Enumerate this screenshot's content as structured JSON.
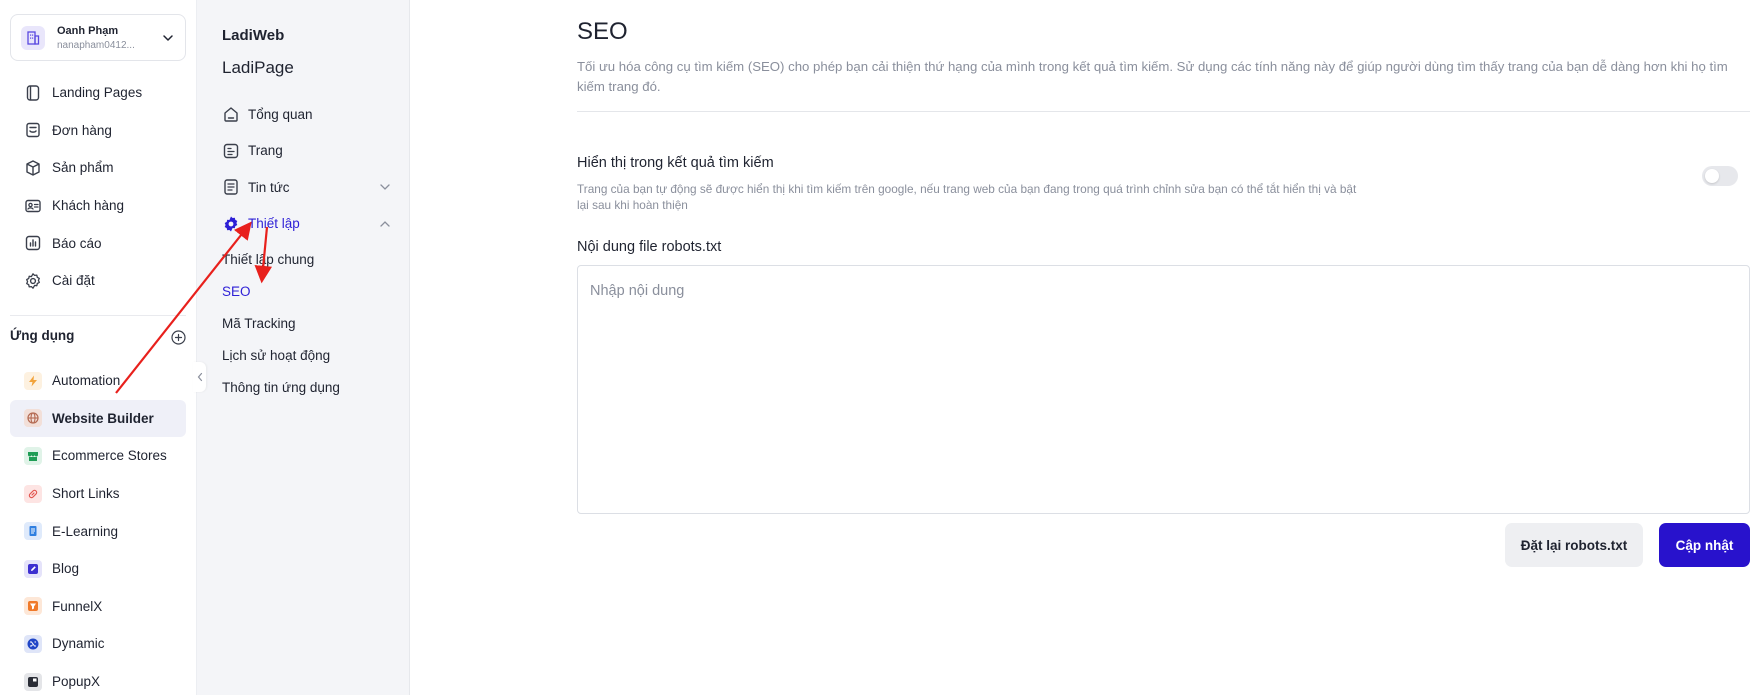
{
  "account": {
    "name": "Oanh Phạm",
    "email": "nanapham0412...",
    "icon": "building-icon"
  },
  "nav": {
    "items": [
      {
        "label": "Landing Pages",
        "icon": "landing-pages-icon"
      },
      {
        "label": "Đơn hàng",
        "icon": "orders-icon"
      },
      {
        "label": "Sản phẩm",
        "icon": "box-icon"
      },
      {
        "label": "Khách hàng",
        "icon": "contact-card-icon"
      },
      {
        "label": "Báo cáo",
        "icon": "report-icon"
      },
      {
        "label": "Cài đặt",
        "icon": "gear-icon"
      }
    ]
  },
  "apps": {
    "title": "Ứng dụng",
    "items": [
      {
        "label": "Automation",
        "icon": "lightning-icon",
        "color": "#f2a33a",
        "bg": "#fdf1e0"
      },
      {
        "label": "Website Builder",
        "icon": "globe-icon",
        "color": "#b46a52",
        "bg": "#f2dfd8",
        "active": true
      },
      {
        "label": "Ecommerce Stores",
        "icon": "store-icon",
        "color": "#1f9d55",
        "bg": "#e0f3e8"
      },
      {
        "label": "Short Links",
        "icon": "link-icon",
        "color": "#e2554f",
        "bg": "#fde4e3"
      },
      {
        "label": "E-Learning",
        "icon": "book-icon",
        "color": "#2f7fe0",
        "bg": "#dfeafb"
      },
      {
        "label": "Blog",
        "icon": "pencil-square-icon",
        "color": "#3d2fd0",
        "bg": "#e5e3fa"
      },
      {
        "label": "FunnelX",
        "icon": "funnel-icon",
        "color": "#f07a2a",
        "bg": "#fde7d7"
      },
      {
        "label": "Dynamic",
        "icon": "shuffle-icon",
        "color": "#2146c7",
        "bg": "#dfe5f8"
      },
      {
        "label": "PopupX",
        "icon": "popup-icon",
        "color": "#2a2d36",
        "bg": "#e4e5e8"
      }
    ]
  },
  "site": {
    "brand": "LadiWeb",
    "name": "LadiPage"
  },
  "menu": {
    "items": [
      {
        "label": "Tổng quan",
        "icon": "home-icon"
      },
      {
        "label": "Trang",
        "icon": "page-icon"
      },
      {
        "label": "Tin tức",
        "icon": "news-icon"
      },
      {
        "label": "Thiết lập",
        "icon": "gear-icon"
      }
    ],
    "sub": [
      "Thiết lập chung",
      "SEO",
      "Mã Tracking",
      "Lịch sử hoạt động",
      "Thông tin ứng dụng"
    ]
  },
  "main": {
    "title": "SEO",
    "description": "Tối ưu hóa công cụ tìm kiếm (SEO) cho phép bạn cải thiện thứ hạng của mình trong kết quả tìm kiếm. Sử dụng các tính năng này để giúp người dùng tìm thấy trang của bạn dễ dàng hơn khi họ tìm kiếm trang đó.",
    "search_visibility": {
      "title": "Hiển thị trong kết quả tìm kiếm",
      "description": "Trang của bạn tự động sẽ được hiển thị khi tìm kiếm trên google, nếu trang web của bạn đang trong quá trình chỉnh sửa bạn có thể tắt hiển thị và bật lại sau khi hoàn thiện",
      "enabled": false
    },
    "robots": {
      "label": "Nội dung file robots.txt",
      "placeholder": "Nhập nội dung",
      "value": ""
    },
    "buttons": {
      "reset": "Đặt lại robots.txt",
      "update": "Cập nhật"
    }
  },
  "colors": {
    "accent": "#2812cc",
    "active_text": "#2d1fd6",
    "annotation": "#e8201c"
  }
}
